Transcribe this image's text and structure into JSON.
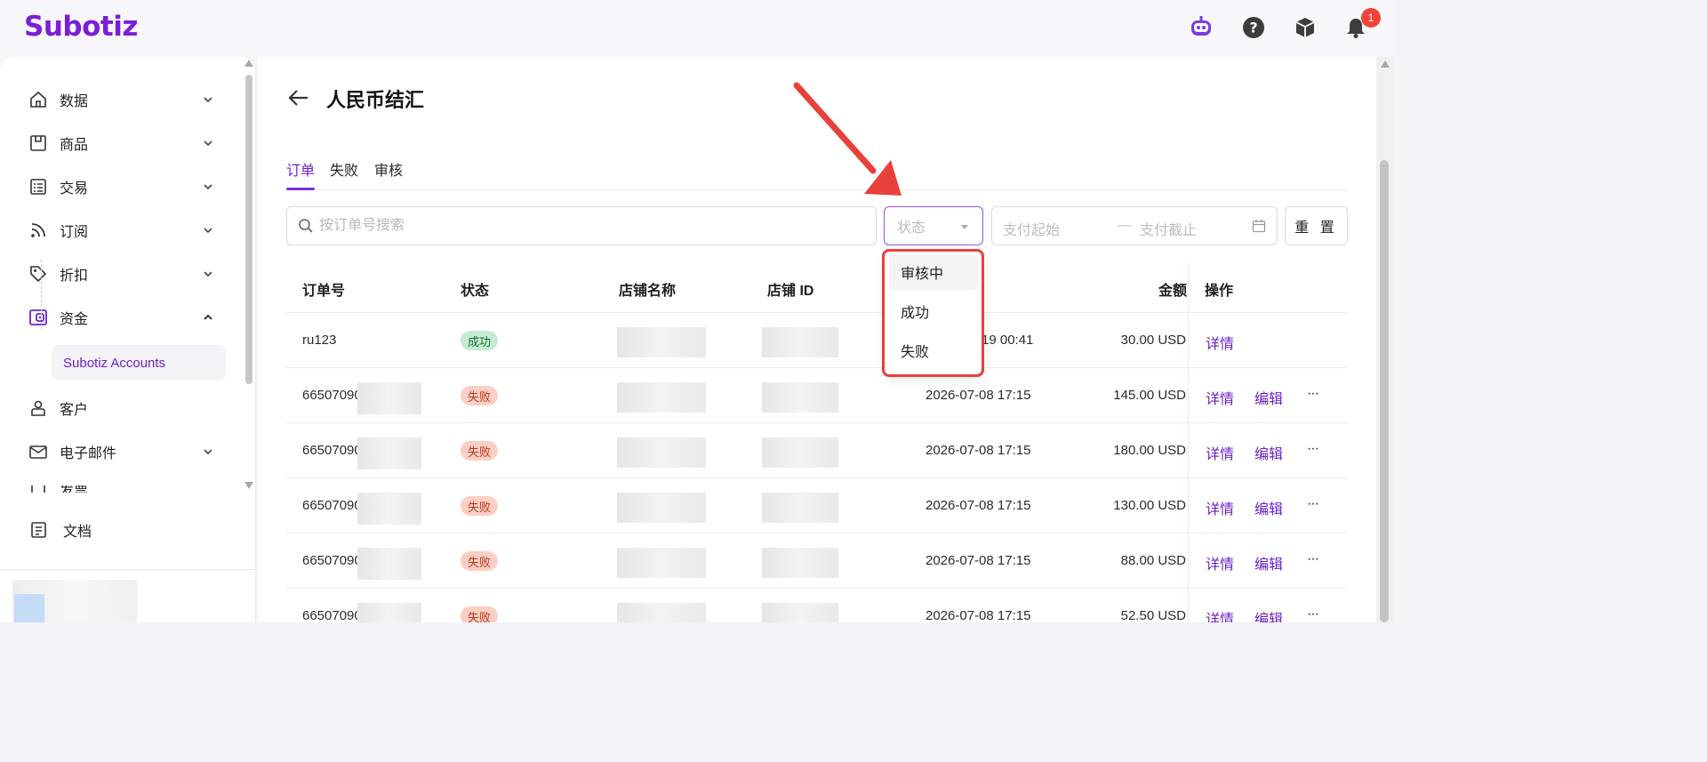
{
  "app": {
    "logo": "Subotiz",
    "notification_count": "1"
  },
  "sidebar": {
    "items": [
      {
        "label": "数据",
        "icon": "home-icon",
        "expanded": false
      },
      {
        "label": "商品",
        "icon": "store-icon",
        "expanded": false
      },
      {
        "label": "交易",
        "icon": "list-icon",
        "expanded": false
      },
      {
        "label": "订阅",
        "icon": "rss-icon",
        "expanded": false
      },
      {
        "label": "折扣",
        "icon": "tag-icon",
        "expanded": false
      },
      {
        "label": "资金",
        "icon": "wallet-icon",
        "expanded": true
      },
      {
        "label": "客户",
        "icon": "user-icon",
        "expanded": false
      },
      {
        "label": "电子邮件",
        "icon": "mail-icon",
        "expanded": false
      },
      {
        "label": "发票",
        "icon": "invoice-icon",
        "expanded": false
      }
    ],
    "active_sub": "Subotiz Accounts",
    "docs_label": "文档"
  },
  "page": {
    "title": "人民币结汇"
  },
  "tabs": [
    {
      "label": "订单",
      "active": true
    },
    {
      "label": "失败",
      "active": false
    },
    {
      "label": "审核",
      "active": false
    }
  ],
  "filters": {
    "search_placeholder": "按订单号搜索",
    "status_placeholder": "状态",
    "date_start_placeholder": "支付起始",
    "date_sep": "—",
    "date_end_placeholder": "支付截止",
    "reset_label": "重 置"
  },
  "status_dropdown": {
    "options": [
      "审核中",
      "成功",
      "失败"
    ],
    "hovered": "审核中"
  },
  "table": {
    "columns": [
      "订单号",
      "状态",
      "店铺名称",
      "店铺 ID",
      "金额",
      "操作"
    ],
    "rows": [
      {
        "order": "ru123",
        "status": "成功",
        "status_type": "ok",
        "time": "19 00:41",
        "amount": "30.00 USD",
        "actions": [
          "详情"
        ]
      },
      {
        "order": "66507090",
        "status": "失败",
        "status_type": "fail",
        "time": "2026-07-08 17:15",
        "amount": "145.00 USD",
        "actions": [
          "详情",
          "编辑"
        ]
      },
      {
        "order": "66507090",
        "status": "失败",
        "status_type": "fail",
        "time": "2026-07-08 17:15",
        "amount": "180.00 USD",
        "actions": [
          "详情",
          "编辑"
        ]
      },
      {
        "order": "66507090",
        "status": "失败",
        "status_type": "fail",
        "time": "2026-07-08 17:15",
        "amount": "130.00 USD",
        "actions": [
          "详情",
          "编辑"
        ]
      },
      {
        "order": "66507090",
        "status": "失败",
        "status_type": "fail",
        "time": "2026-07-08 17:15",
        "amount": "88.00 USD",
        "actions": [
          "详情",
          "编辑"
        ]
      },
      {
        "order": "66507090",
        "status": "失败",
        "status_type": "fail",
        "time": "2026-07-08 17:15",
        "amount": "52.50 USD",
        "actions": [
          "详情",
          "编辑"
        ]
      }
    ],
    "more_label": "···"
  },
  "colors": {
    "brand": "#7a1fd6",
    "link": "#6b21c8",
    "annotation": "#e8413b"
  }
}
